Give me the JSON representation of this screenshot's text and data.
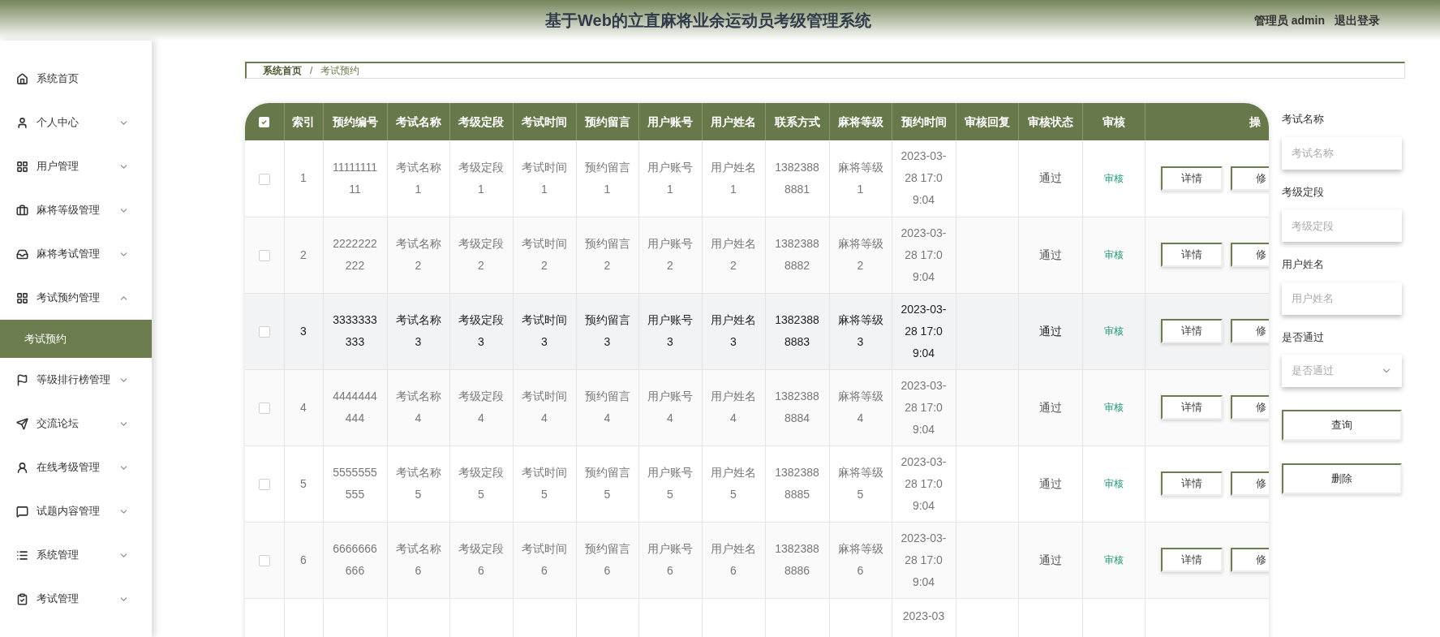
{
  "header": {
    "title": "基于Web的立直麻将业余运动员考级管理系统",
    "user": "管理员 admin",
    "logout": "退出登录"
  },
  "sidebar": {
    "items": [
      {
        "label": "系统首页",
        "kind": "link"
      },
      {
        "label": "个人中心",
        "kind": "menu",
        "expanded": false
      },
      {
        "label": "用户管理",
        "kind": "menu",
        "expanded": false
      },
      {
        "label": "麻将等级管理",
        "kind": "menu",
        "expanded": false
      },
      {
        "label": "麻将考试管理",
        "kind": "menu",
        "expanded": false
      },
      {
        "label": "考试预约管理",
        "kind": "menu",
        "expanded": true,
        "children": [
          {
            "label": "考试预约",
            "selected": true
          }
        ]
      },
      {
        "label": "等级排行榜管理",
        "kind": "menu",
        "expanded": false
      },
      {
        "label": "交流论坛",
        "kind": "menu",
        "expanded": false
      },
      {
        "label": "在线考级管理",
        "kind": "menu",
        "expanded": false
      },
      {
        "label": "试题内容管理",
        "kind": "menu",
        "expanded": false
      },
      {
        "label": "系统管理",
        "kind": "menu",
        "expanded": false
      },
      {
        "label": "考试管理",
        "kind": "menu",
        "expanded": false
      }
    ]
  },
  "breadcrumb": [
    "系统首页",
    "/",
    "考试预约"
  ],
  "table": {
    "select_all_checked": true,
    "columns": [
      "索引",
      "预约编号",
      "考试名称",
      "考级定段",
      "考试时间",
      "预约留言",
      "用户账号",
      "用户姓名",
      "联系方式",
      "麻将等级",
      "预约时间",
      "审核回复",
      "审核状态",
      "审核",
      "操"
    ],
    "rows": [
      {
        "checked": false,
        "hovered": false,
        "cells": [
          "1",
          "1111111111",
          "考试名称1",
          "考级定段1",
          "考试时间1",
          "预约留言1",
          "用户账号1",
          "用户姓名1",
          "13823888881",
          "麻将等级1",
          "2023-03-28 17:09:04"
        ],
        "status": "通过",
        "review": "审核",
        "actions": [
          "详情",
          "修"
        ]
      },
      {
        "checked": false,
        "hovered": false,
        "cells": [
          "2",
          "2222222222",
          "考试名称2",
          "考级定段2",
          "考试时间2",
          "预约留言2",
          "用户账号2",
          "用户姓名2",
          "13823888882",
          "麻将等级2",
          "2023-03-28 17:09:04"
        ],
        "status": "通过",
        "review": "审核",
        "actions": [
          "详情",
          "修"
        ]
      },
      {
        "checked": false,
        "hovered": true,
        "cells": [
          "3",
          "3333333333",
          "考试名称3",
          "考级定段3",
          "考试时间3",
          "预约留言3",
          "用户账号3",
          "用户姓名3",
          "13823888883",
          "麻将等级3",
          "2023-03-28 17:09:04"
        ],
        "status": "通过",
        "review": "审核",
        "actions": [
          "详情",
          "修"
        ]
      },
      {
        "checked": false,
        "hovered": false,
        "cells": [
          "4",
          "4444444444",
          "考试名称4",
          "考级定段4",
          "考试时间4",
          "预约留言4",
          "用户账号4",
          "用户姓名4",
          "13823888884",
          "麻将等级4",
          "2023-03-28 17:09:04"
        ],
        "status": "通过",
        "review": "审核",
        "actions": [
          "详情",
          "修"
        ]
      },
      {
        "checked": false,
        "hovered": false,
        "cells": [
          "5",
          "5555555555",
          "考试名称5",
          "考级定段5",
          "考试时间5",
          "预约留言5",
          "用户账号5",
          "用户姓名5",
          "13823888885",
          "麻将等级5",
          "2023-03-28 17:09:04"
        ],
        "status": "通过",
        "review": "审核",
        "actions": [
          "详情",
          "修"
        ]
      },
      {
        "checked": false,
        "hovered": false,
        "cells": [
          "6",
          "6666666666",
          "考试名称6",
          "考级定段6",
          "考试时间6",
          "预约留言6",
          "用户账号6",
          "用户姓名6",
          "13823888886",
          "麻将等级6",
          "2023-03-28 17:09:04"
        ],
        "status": "通过",
        "review": "审核",
        "actions": [
          "详情",
          "修"
        ]
      }
    ],
    "partial_row": {
      "booking_time": "2023-03"
    }
  },
  "filters": [
    {
      "label": "考试名称",
      "kind": "text",
      "placeholder": "考试名称"
    },
    {
      "label": "考级定段",
      "kind": "text",
      "placeholder": "考级定段"
    },
    {
      "label": "用户姓名",
      "kind": "text",
      "placeholder": "用户姓名"
    },
    {
      "label": "是否通过",
      "kind": "select",
      "placeholder": "是否通过"
    }
  ],
  "buttons": [
    "查询",
    "删除"
  ]
}
